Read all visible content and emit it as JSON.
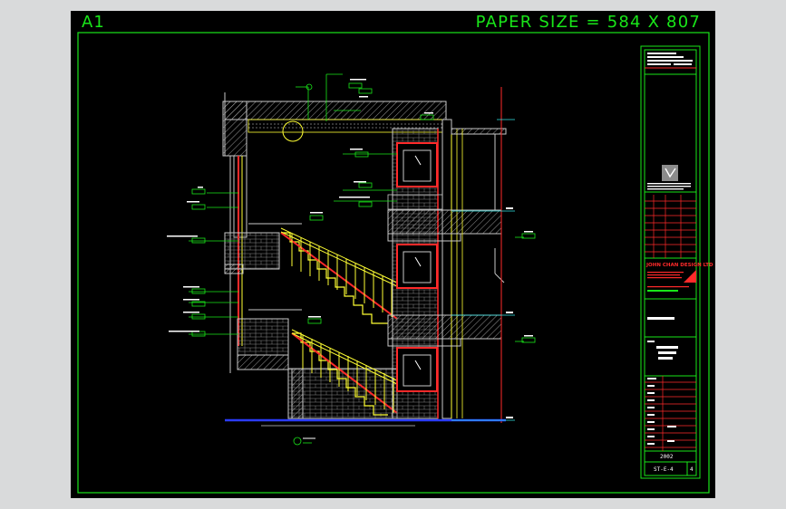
{
  "sheet": {
    "corner_label": "A1",
    "paper_size": "PAPER SIZE = 584 X 807"
  },
  "title_block": {
    "company": "JOHN CHAN DESIGN LTD",
    "drawing_number": "ST-E-4",
    "sheet_number": "4",
    "year": "2002"
  },
  "colors": {
    "background": "#000000",
    "frame": "#19e619",
    "wall_hatch": "#c8c8c8",
    "stair": "#ffff33",
    "red": "#ff2a2a",
    "annotation": "#19e619",
    "cyan": "#33e6e6",
    "blue": "#2b3cff"
  }
}
